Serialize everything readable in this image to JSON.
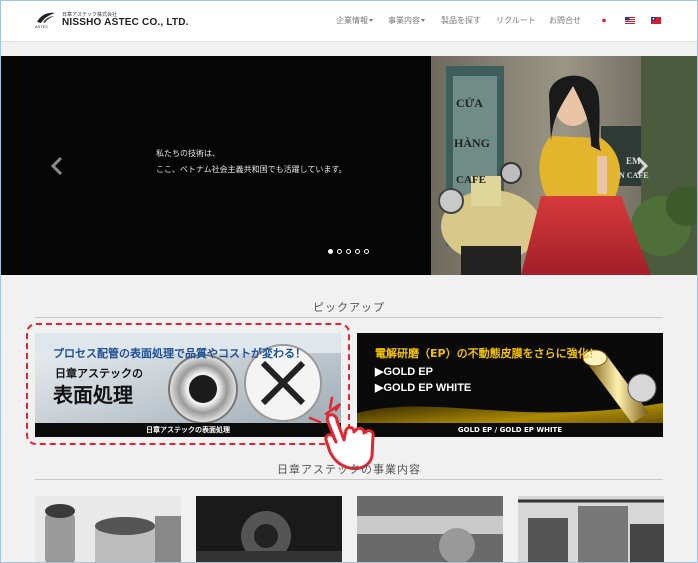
{
  "header": {
    "logo_sub": "日章アステック株式会社",
    "logo_main": "NISSHO ASTEC CO., LTD.",
    "logo_mark_text": "ASTEC",
    "nav": [
      {
        "label": "企業情報",
        "dropdown": true
      },
      {
        "label": "事業内容",
        "dropdown": true
      },
      {
        "label": "製品を探す",
        "dropdown": false
      },
      {
        "label": "リクルート",
        "dropdown": false
      },
      {
        "label": "お問合せ",
        "dropdown": false
      }
    ],
    "flags": [
      "japan-flag-icon",
      "usa-flag-icon",
      "taiwan-flag-icon"
    ]
  },
  "hero": {
    "line1": "私たちの技術は、",
    "line2": "ここ、ベトナム社会主義共和国でも活躍しています。",
    "sign_line1": "CỬA",
    "sign_line2": "HÀNG",
    "sign_line3": "CAFE",
    "sign_right1": "EM",
    "sign_right2": "N CAFE",
    "slides_total": 5,
    "active_slide": 1
  },
  "pickup": {
    "title": "ピックアップ",
    "banner1": {
      "headline": "プロセス配管の表面処理で品質やコストが変わる！",
      "sub": "日章アステックの",
      "main": "表面処理",
      "caption": "日章アステックの表面処理"
    },
    "banner2": {
      "headline": "電解研磨（EP）の不動態皮膜をさらに強化！",
      "line1": "GOLD EP",
      "line2": "GOLD EP WHITE",
      "caption": "GOLD EP / GOLD EP WHITE"
    }
  },
  "business": {
    "title": "日章アステックの事業内容"
  },
  "colors": {
    "accent_red": "#e0262f",
    "banner1_blue": "#1f4f95",
    "banner2_gold": "#f2c200",
    "nav_text": "#777777"
  }
}
